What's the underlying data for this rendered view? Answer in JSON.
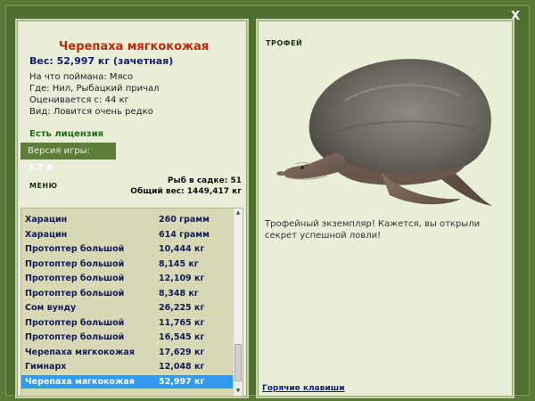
{
  "window": {
    "close_label": "X"
  },
  "fish": {
    "title": "Черепаха мягкокожая",
    "weight_line": "Вес: 52,997 кг (зачетная)",
    "caught_on": "На что поймана: Мясо",
    "location": "Где: Нил, Рыбацкий причал",
    "value": "Оценивается с: 44 кг",
    "rarity": "Вид: Ловится очень редко"
  },
  "license_label": "Есть лицензия",
  "version": {
    "label": "Версия игры:",
    "number": "3.7.6"
  },
  "menu_label": "МЕНЮ",
  "cage": {
    "count_line": "Рыб в садке: 51",
    "total_line": "Общий вес: 1449,417 кг"
  },
  "catch_list": [
    {
      "name": "Харацин",
      "weight": "260 грамм"
    },
    {
      "name": "Харацин",
      "weight": "614 грамм"
    },
    {
      "name": "Протоптер большой",
      "weight": "10,444 кг"
    },
    {
      "name": "Протоптер большой",
      "weight": "8,145 кг"
    },
    {
      "name": "Протоптер большой",
      "weight": "12,109 кг"
    },
    {
      "name": "Протоптер большой",
      "weight": "8,348 кг"
    },
    {
      "name": "Сом вунду",
      "weight": "26,225 кг"
    },
    {
      "name": "Протоптер большой",
      "weight": "11,765 кг"
    },
    {
      "name": "Протоптер большой",
      "weight": "16,545 кг"
    },
    {
      "name": "Черепаха мягкокожая",
      "weight": "17,629 кг"
    },
    {
      "name": "Гимнарх",
      "weight": "12,048 кг"
    },
    {
      "name": "Черепаха мягкокожая",
      "weight": "52,997 кг"
    }
  ],
  "selected_index": 11,
  "trophy": {
    "label": "ТРОФЕЙ",
    "image_icon": "softshell-turtle-image",
    "text": "Трофейный экземпляр! Кажется, вы открыли секрет успешной ловли!"
  },
  "hotkeys_label": "Горячие клавиши",
  "colors": {
    "background": "#5b7a3a",
    "panel": "#e9eed8",
    "title_red": "#c02a0a",
    "selected_row": "#3399ee"
  }
}
